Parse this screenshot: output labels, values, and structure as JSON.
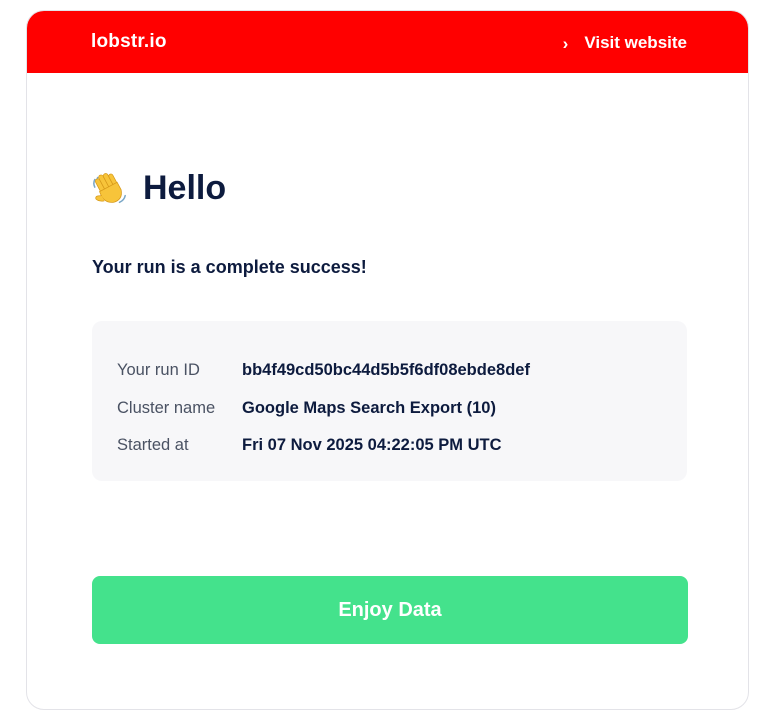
{
  "header": {
    "brand": "lobstr.io",
    "visit_label": "Visit website",
    "background_color": "#ff0000"
  },
  "greeting": {
    "icon": "waving-hand-icon",
    "title": "Hello"
  },
  "subtitle": "Your run is a complete success!",
  "details": [
    {
      "label": "Your run ID",
      "value": "bb4f49cd50bc44d5b5f6df08ebde8def"
    },
    {
      "label": "Cluster name",
      "value": "Google Maps Search Export (10)"
    },
    {
      "label": "Started at",
      "value": "Fri 07 Nov 2025 04:22:05 PM UTC"
    }
  ],
  "cta": {
    "label": "Enjoy Data",
    "color": "#44e28c"
  }
}
